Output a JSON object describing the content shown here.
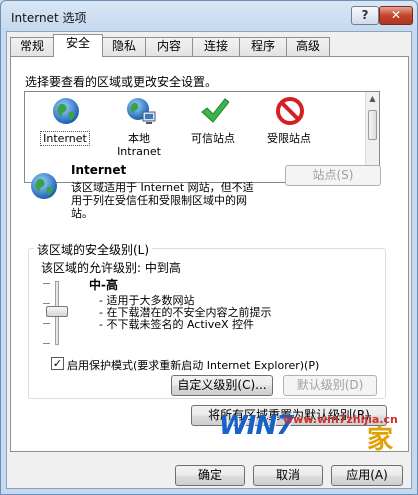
{
  "window": {
    "title": "Internet 选项",
    "help_label": "?",
    "close_label": "✕"
  },
  "tabs": [
    {
      "label": "常规",
      "active": false
    },
    {
      "label": "安全",
      "active": true
    },
    {
      "label": "隐私",
      "active": false
    },
    {
      "label": "内容",
      "active": false
    },
    {
      "label": "连接",
      "active": false
    },
    {
      "label": "程序",
      "active": false
    },
    {
      "label": "高级",
      "active": false
    }
  ],
  "security": {
    "zones_caption": "选择要查看的区域或更改安全设置。",
    "zones": [
      {
        "label": "Internet",
        "icon": "globe-icon",
        "selected": true
      },
      {
        "label": "本地\nIntranet",
        "icon": "intranet-globe-icon",
        "selected": false
      },
      {
        "label": "可信站点",
        "icon": "checkmark-icon",
        "selected": false
      },
      {
        "label": "受限站点",
        "icon": "restricted-icon",
        "selected": false
      }
    ],
    "zone_info": {
      "name": "Internet",
      "description": "该区域适用于 Internet 网站，但不适用于列在受信任和受限制区域中的网站。",
      "sites_button": "站点(S)"
    },
    "level_group_title": "该区域的安全级别(L)",
    "allowed_levels": "该区域的允许级别: 中到高",
    "level_name": "中-高",
    "level_bullets": [
      "- 适用于大多数网站",
      "- 在下载潜在的不安全内容之前提示",
      "- 不下载未签名的 ActiveX 控件"
    ],
    "protected_mode_label": "启用保护模式(要求重新启动 Internet Explorer)(P)",
    "protected_mode_checked": true,
    "custom_level_button": "自定义级别(C)...",
    "default_level_button": "默认级别(D)",
    "reset_all_button": "将所有区域重置为默认级别(R)"
  },
  "footer": {
    "ok_label": "确定",
    "cancel_label": "取消",
    "apply_label": "应用(A)"
  },
  "watermark": {
    "logo": "WIN7",
    "url": "www.win7zhijia.cn",
    "suffix": "家"
  },
  "colors": {
    "title_bg": "#c6d9ee",
    "close_red": "#c2452c",
    "accent_blue": "#1861c6"
  }
}
